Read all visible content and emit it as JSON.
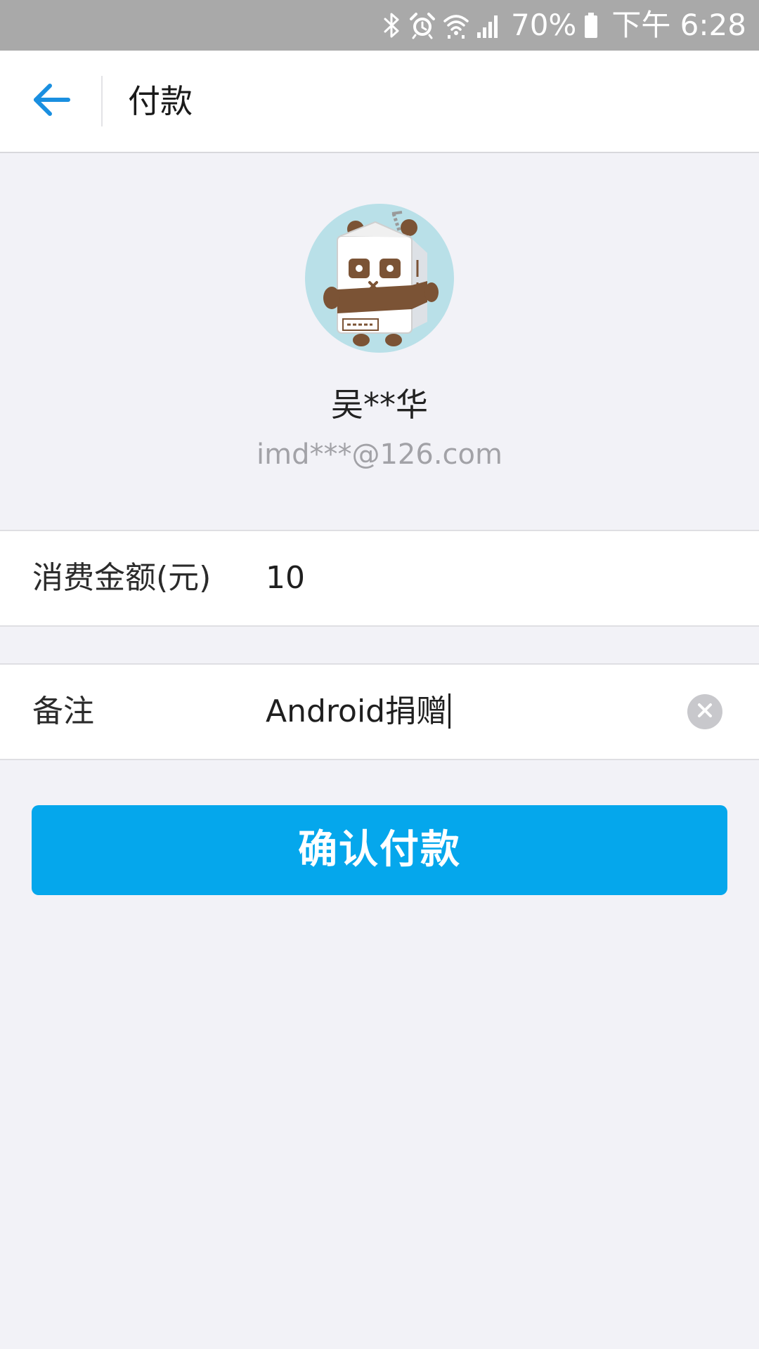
{
  "status_bar": {
    "battery": "70%",
    "time": "下午 6:28",
    "icons": [
      "bluetooth-icon",
      "alarm-icon",
      "wifi-icon",
      "signal-icon",
      "battery-icon"
    ]
  },
  "app_bar": {
    "title": "付款",
    "back_icon": "back-arrow-icon"
  },
  "profile": {
    "name": "吴**华",
    "email": "imd***@126.com"
  },
  "form": {
    "amount": {
      "label": "消费金额(元)",
      "value": "10"
    },
    "note": {
      "label": "备注",
      "value": "Android捐赠"
    }
  },
  "confirm_button": {
    "label": "确认付款"
  },
  "colors": {
    "accent": "#05a7ec",
    "back_arrow": "#1a8fe0",
    "status_bar": "#a9a9a9",
    "background": "#f2f2f7"
  }
}
